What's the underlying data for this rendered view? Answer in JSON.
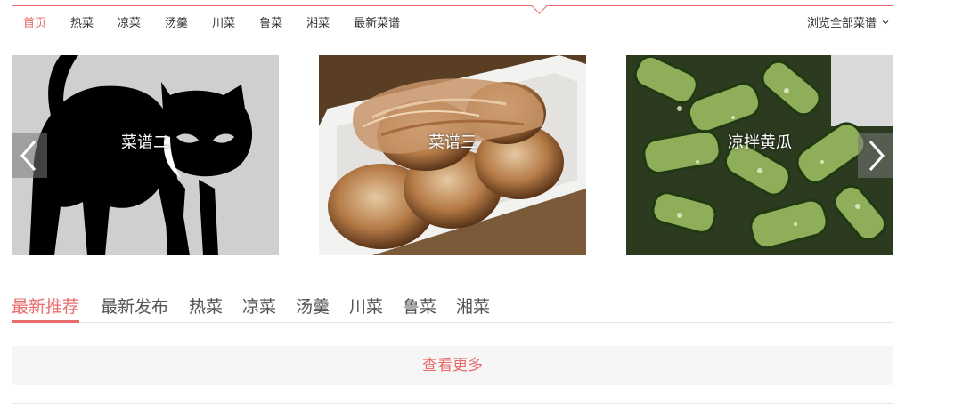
{
  "nav": {
    "items": [
      {
        "label": "首页",
        "active": true
      },
      {
        "label": "热菜",
        "active": false
      },
      {
        "label": "凉菜",
        "active": false
      },
      {
        "label": "汤羹",
        "active": false
      },
      {
        "label": "川菜",
        "active": false
      },
      {
        "label": "鲁菜",
        "active": false
      },
      {
        "label": "湘菜",
        "active": false
      },
      {
        "label": "最新菜谱",
        "active": false
      }
    ],
    "browse_all": "浏览全部菜谱",
    "accent_color": "#e96b6b"
  },
  "carousel": {
    "slides": [
      {
        "title": "菜谱二",
        "image": "black-cat-silhouette"
      },
      {
        "title": "菜谱三",
        "image": "takoyaki-dish"
      },
      {
        "title": "凉拌黄瓜",
        "image": "smashed-cucumber-salad"
      }
    ],
    "prev_icon": "chevron-left-icon",
    "next_icon": "chevron-right-icon"
  },
  "tabs": [
    {
      "label": "最新推荐",
      "active": true
    },
    {
      "label": "最新发布",
      "active": false
    },
    {
      "label": "热菜",
      "active": false
    },
    {
      "label": "凉菜",
      "active": false
    },
    {
      "label": "汤羹",
      "active": false
    },
    {
      "label": "川菜",
      "active": false
    },
    {
      "label": "鲁菜",
      "active": false
    },
    {
      "label": "湘菜",
      "active": false
    }
  ],
  "load_more": "查看更多"
}
